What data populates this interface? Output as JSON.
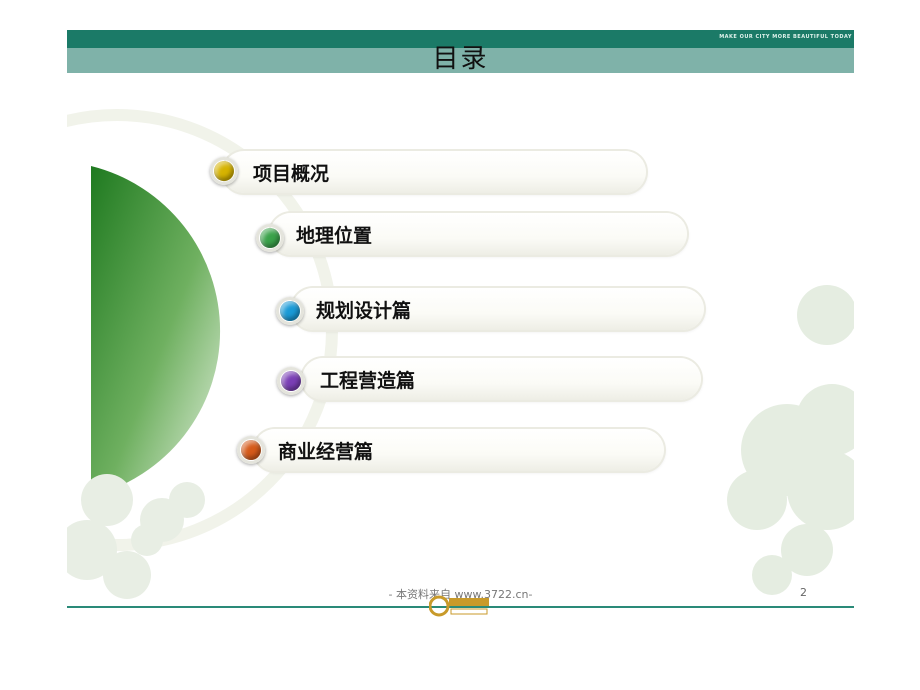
{
  "header": {
    "slogan": "MAKE OUR CITY MORE BEAUTIFUL TODAY",
    "title": "目录"
  },
  "menu": {
    "items": [
      {
        "label": "项目概况",
        "icon": "yellow-ball-icon",
        "color": "#d6b300"
      },
      {
        "label": "地理位置",
        "icon": "green-ball-icon",
        "color": "#3aa24a"
      },
      {
        "label": "规划设计篇",
        "icon": "blue-ball-icon",
        "color": "#1a9ad6"
      },
      {
        "label": "工程营造篇",
        "icon": "purple-ball-icon",
        "color": "#7a3fb5"
      },
      {
        "label": "商业经营篇",
        "icon": "orange-ball-icon",
        "color": "#d55a1a"
      }
    ]
  },
  "footer": {
    "source": "- 本资料来自 www.3722.cn-",
    "page_number": "2"
  },
  "colors": {
    "header_dark": "#1b7a67",
    "header_light": "#7fb2a9",
    "accent_green": "#2a8a2a"
  }
}
